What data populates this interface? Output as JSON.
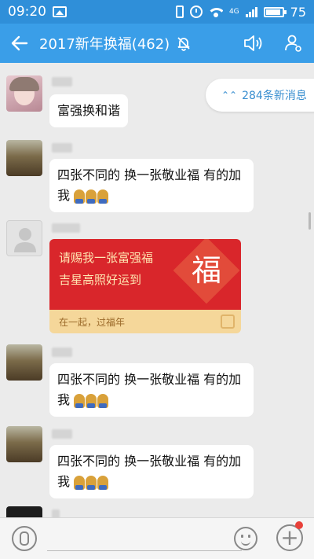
{
  "status_bar": {
    "time": "09:20",
    "network": "4G",
    "battery": "75"
  },
  "header": {
    "title": "2017新年换福(462)",
    "icons": [
      "back-arrow-icon",
      "mute-bell-icon",
      "speaker-icon",
      "group-members-icon"
    ]
  },
  "new_messages_label": "284条新消息",
  "messages": [
    {
      "text": "富强换和谐"
    },
    {
      "text": "四张不同的 换一张敬业福 有的加我"
    },
    {
      "card": {
        "line1": "请赐我一张富强福",
        "line2": "吉星高照好运到",
        "fu": "福",
        "footer": "在一起，过福年"
      }
    },
    {
      "text": "四张不同的 换一张敬业福 有的加我"
    },
    {
      "text": "四张不同的 换一张敬业福 有的加我"
    }
  ],
  "input_bar": {
    "icons": [
      "microphone-icon",
      "emoji-icon",
      "plus-icon"
    ]
  },
  "colors": {
    "header": "#3a9ee8",
    "status_bar": "#2f8fd9",
    "card_red": "#d9262b",
    "card_footer": "#f5d79a"
  }
}
